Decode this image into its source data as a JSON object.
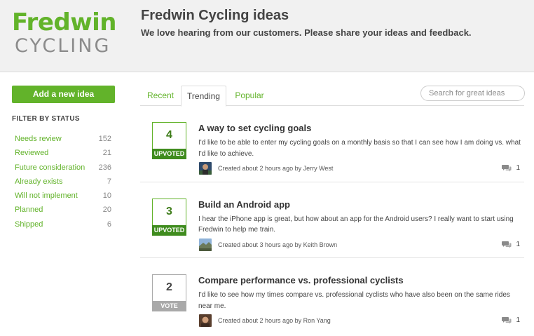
{
  "header": {
    "logo_top": "Fredwin",
    "logo_bottom": "CYCLING",
    "title": "Fredwin Cycling ideas",
    "subtitle": "We love hearing from our customers. Please share your ideas and feedback."
  },
  "sidebar": {
    "add_button": "Add a new idea",
    "filter_heading": "FILTER BY STATUS",
    "filters": [
      {
        "label": "Needs review",
        "count": "152"
      },
      {
        "label": "Reviewed",
        "count": "21"
      },
      {
        "label": "Future consideration",
        "count": "236"
      },
      {
        "label": "Already exists",
        "count": "7"
      },
      {
        "label": "Will not implement",
        "count": "10"
      },
      {
        "label": "Planned",
        "count": "20"
      },
      {
        "label": "Shipped",
        "count": "6"
      }
    ]
  },
  "tabs": [
    {
      "label": "Recent",
      "active": false
    },
    {
      "label": "Trending",
      "active": true
    },
    {
      "label": "Popular",
      "active": false
    }
  ],
  "search": {
    "placeholder": "Search for great ideas"
  },
  "ideas": [
    {
      "votes": "4",
      "vote_label": "UPVOTED",
      "title": "A way to set cycling goals",
      "description": "I'd like to be able to enter my cycling goals on a monthly basis so that I can see how I am doing vs. what I'd like to achieve.",
      "meta": "Created about 2 hours ago by Jerry West",
      "comments": "1"
    },
    {
      "votes": "3",
      "vote_label": "UPVOTED",
      "title": "Build an Android app",
      "description": "I hear the iPhone app is great, but how about an app for the Android users? I really want to start using Fredwin to help me train.",
      "meta": "Created about 3 hours ago by Keith Brown",
      "comments": "1"
    },
    {
      "votes": "2",
      "vote_label": "VOTE",
      "title": "Compare performance vs. professional cyclists",
      "description": "I'd like to see how my times compare vs. professional cyclists who have also been on the same rides near me.",
      "meta": "Created about 2 hours ago by Ron Yang",
      "comments": "1"
    }
  ],
  "colors": {
    "brand_green": "#62b32a",
    "upvoted_green": "#3f8c1e",
    "vote_gray": "#a9a9a9"
  }
}
